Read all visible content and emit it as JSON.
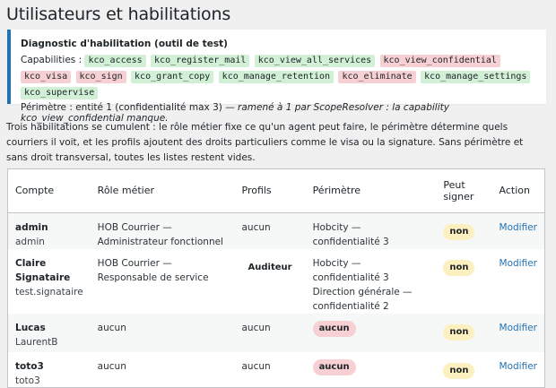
{
  "page": {
    "title": "Utilisateurs et habilitations"
  },
  "diagnostic": {
    "title": "Diagnostic d'habilitation (outil de test)",
    "capabilities_label": "Capabilities :",
    "capabilities": [
      {
        "name": "kco_access",
        "granted": true
      },
      {
        "name": "kco_register_mail",
        "granted": true
      },
      {
        "name": "kco_view_all_services",
        "granted": true
      },
      {
        "name": "kco_view_confidential",
        "granted": false
      },
      {
        "name": "kco_visa",
        "granted": false
      },
      {
        "name": "kco_sign",
        "granted": false
      },
      {
        "name": "kco_grant_copy",
        "granted": true
      },
      {
        "name": "kco_manage_retention",
        "granted": true
      },
      {
        "name": "kco_eliminate",
        "granted": false
      },
      {
        "name": "kco_manage_settings",
        "granted": true
      },
      {
        "name": "kco_supervise",
        "granted": true
      }
    ],
    "perimetre_label": "Périmètre : entité 1 (confidentialité max 3)",
    "perimetre_note": " — ramené à 1 par ScopeResolver : la capability kco_view_confidential manque."
  },
  "intro": "Trois habilitations se cumulent : le rôle métier fixe ce qu'un agent peut faire, le périmètre détermine quels courriers il voit, et les profils ajoutent des droits particuliers comme le visa ou la signature. Sans périmètre et sans droit transversal, toutes les listes restent vides.",
  "table": {
    "headers": {
      "compte": "Compte",
      "role": "Rôle métier",
      "profils": "Profils",
      "perimetre": "Périmètre",
      "signer": "Peut signer",
      "action": "Action"
    },
    "rows": [
      {
        "name": "admin",
        "login": "admin",
        "role": "HOB Courrier — Administrateur fonctionnel",
        "profils": "aucun",
        "profils_tag": false,
        "perimetre": [
          "Hobcity — confidentialité 3"
        ],
        "perimetre_empty": false,
        "signer": "non",
        "action": "Modifier"
      },
      {
        "name": "Claire Signataire",
        "login": "test.signataire",
        "role": "HOB Courrier — Responsable de service",
        "profils": "Auditeur",
        "profils_tag": true,
        "perimetre": [
          "Hobcity — confidentialité 3",
          "Direction générale — confidentialité 2"
        ],
        "perimetre_empty": false,
        "signer": "non",
        "action": "Modifier"
      },
      {
        "name": "Lucas",
        "login": "LaurentB",
        "role": "aucun",
        "profils": "aucun",
        "profils_tag": false,
        "perimetre": [
          "aucun"
        ],
        "perimetre_empty": true,
        "signer": "non",
        "action": "Modifier"
      },
      {
        "name": "toto3",
        "login": "toto3",
        "role": "aucun",
        "profils": "aucun",
        "profils_tag": false,
        "perimetre": [
          "aucun"
        ],
        "perimetre_empty": true,
        "signer": "non",
        "action": "Modifier"
      }
    ]
  },
  "colors": {
    "accent": "#2271b1",
    "granted": "#d1f0d6",
    "denied": "#f6d0d2",
    "warning": "#fcf0c0"
  }
}
